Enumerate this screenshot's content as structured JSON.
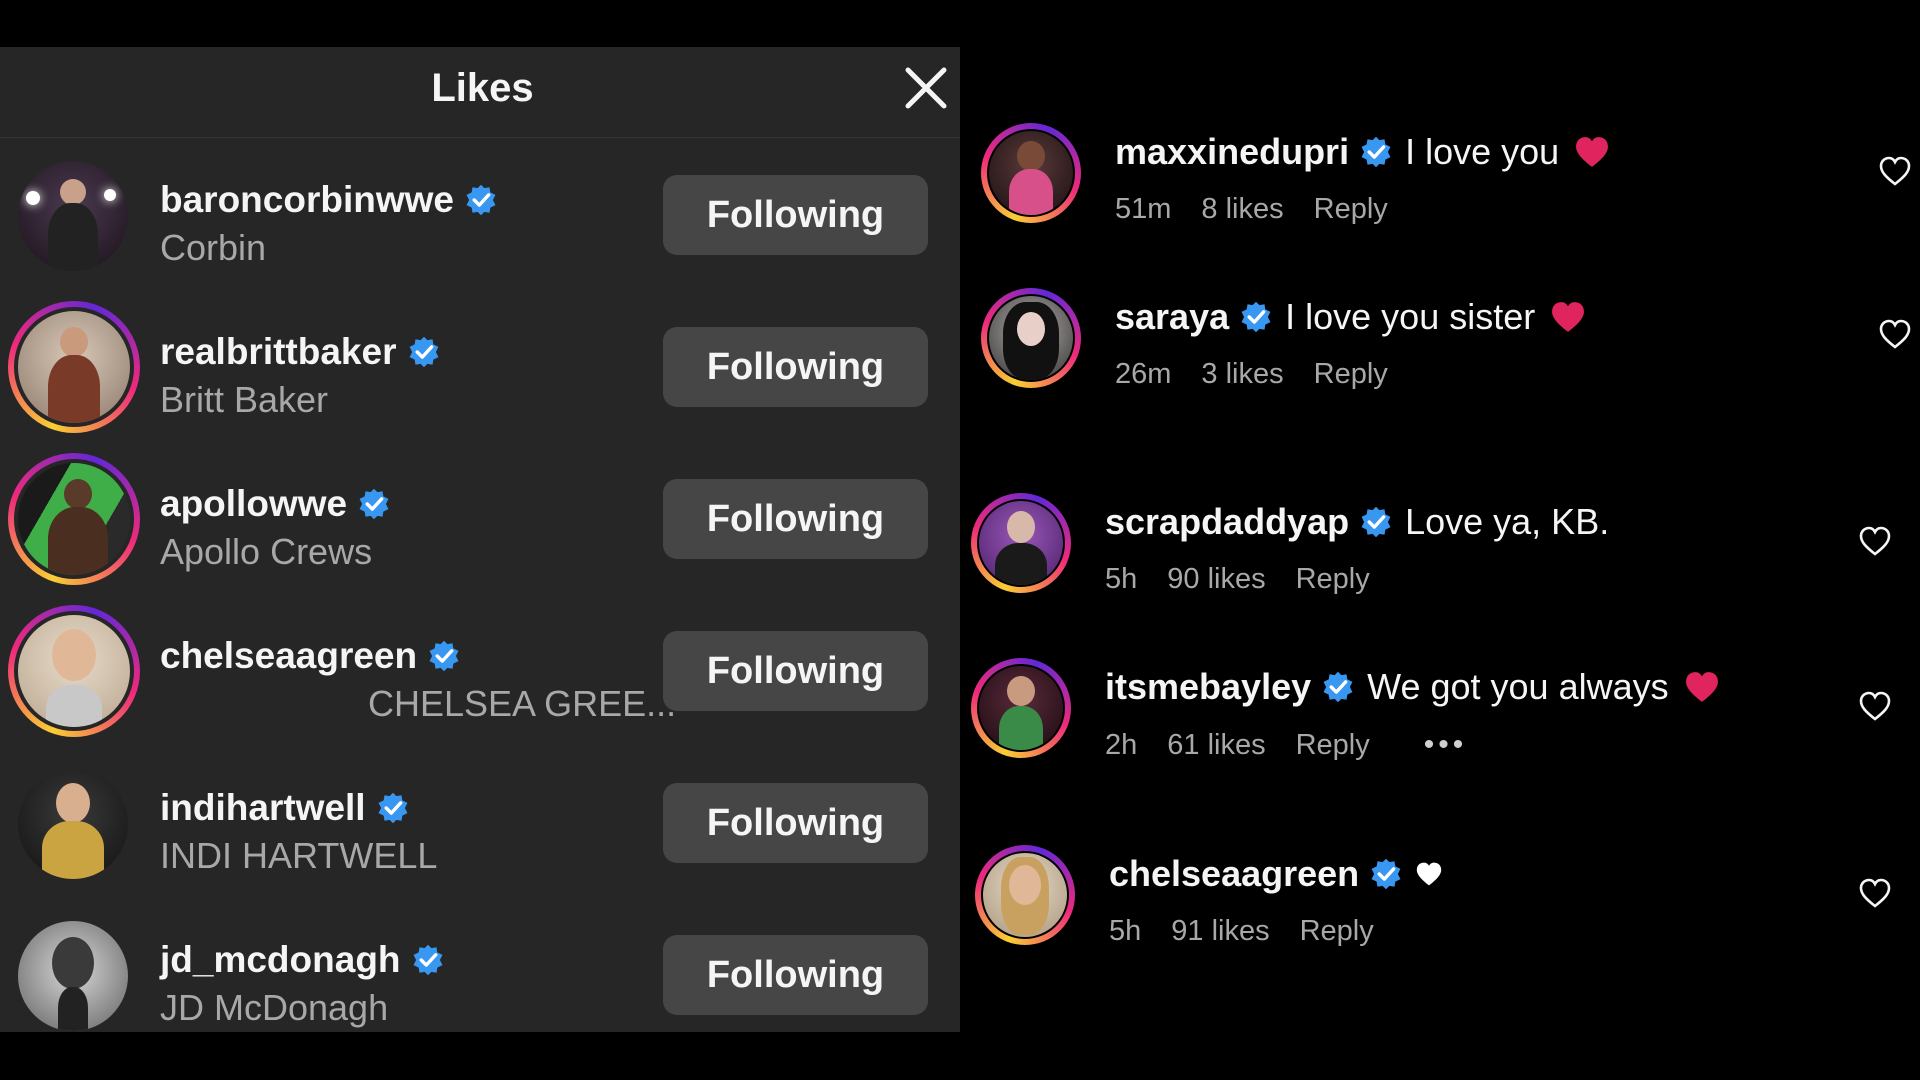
{
  "likes_panel": {
    "title": "Likes",
    "button_label": "Following",
    "rows": [
      {
        "username": "baroncorbinwwe",
        "fullname": "Corbin"
      },
      {
        "username": "realbrittbaker",
        "fullname": "Britt Baker"
      },
      {
        "username": "apollowwe",
        "fullname": "Apollo Crews"
      },
      {
        "username": "chelseaagreen",
        "fullname": "CHELSEA GREE..."
      },
      {
        "username": "indihartwell",
        "fullname": "INDI HARTWELL"
      },
      {
        "username": "jd_mcdonagh",
        "fullname": "JD McDonagh"
      }
    ]
  },
  "comments": [
    {
      "username": "maxxinedupri",
      "text": "I love you",
      "emoji": "red-heart",
      "time": "51m",
      "likes": "8 likes",
      "reply": "Reply"
    },
    {
      "username": "saraya",
      "text": "I love you sister",
      "emoji": "red-heart",
      "time": "26m",
      "likes": "3 likes",
      "reply": "Reply"
    },
    {
      "username": "scrapdaddyap",
      "text": "Love ya, KB.",
      "time": "5h",
      "likes": "90 likes",
      "reply": "Reply"
    },
    {
      "username": "itsmebayley",
      "text": "We got you always",
      "emoji": "red-heart",
      "time": "2h",
      "likes": "61 likes",
      "reply": "Reply",
      "more": "•••"
    },
    {
      "username": "chelseaagreen",
      "text": "",
      "emoji": "white-heart",
      "time": "5h",
      "likes": "91 likes",
      "reply": "Reply"
    }
  ],
  "colors": {
    "panel_bg": "#262626",
    "button_bg": "#464646",
    "verified": "#3897f0",
    "red_heart": "#e0245e",
    "muted_text": "#a8a8a8"
  }
}
